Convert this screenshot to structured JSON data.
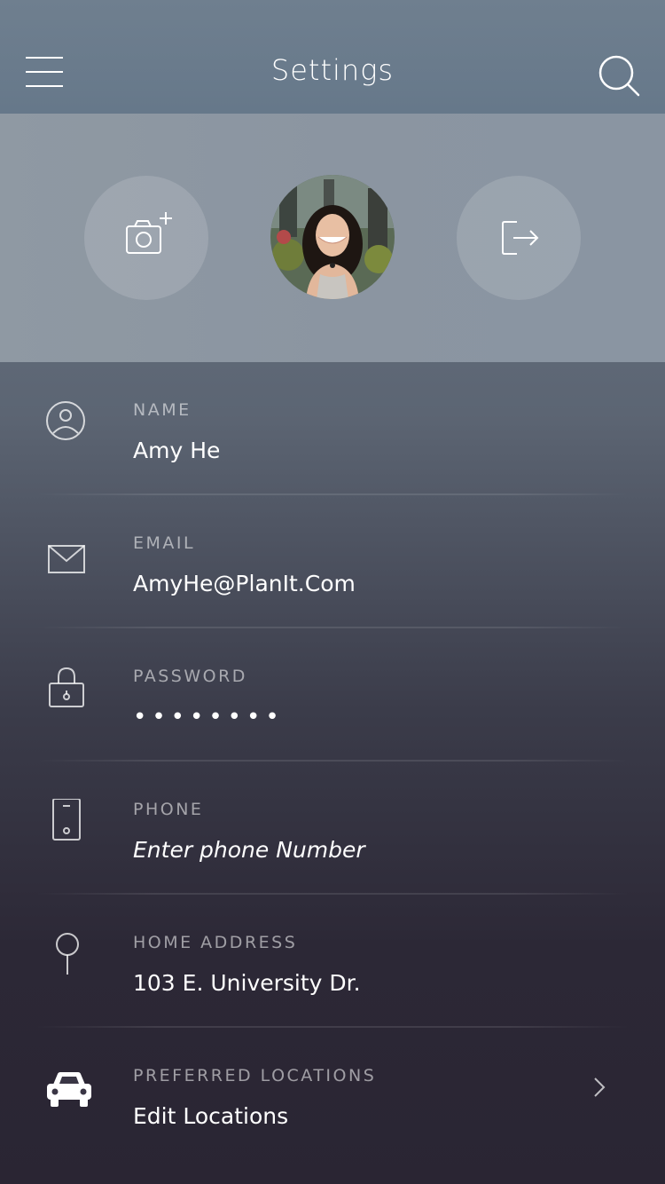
{
  "header": {
    "title": "Settings",
    "menu_icon": "hamburger-menu-icon",
    "search_icon": "search-icon"
  },
  "profile": {
    "add_photo_icon": "camera-plus-icon",
    "logout_icon": "logout-arrow-icon",
    "avatar": "user-avatar-photo"
  },
  "fields": [
    {
      "label": "NAME",
      "value": "Amy He",
      "icon": "user-circle-icon"
    },
    {
      "label": "EMAIL",
      "value": "AmyHe@PlanIt.Com",
      "icon": "envelope-icon"
    },
    {
      "label": "PASSWORD",
      "value": "••••••••",
      "icon": "lock-icon"
    },
    {
      "label": "PHONE",
      "value": "Enter phone Number",
      "icon": "phone-icon"
    },
    {
      "label": "HOME ADDRESS",
      "value": "103 E. University Dr.",
      "icon": "map-pin-icon"
    },
    {
      "label": "PREFERRED LOCATIONS",
      "value": "Edit Locations",
      "icon": "car-icon"
    }
  ],
  "colors": {
    "text": "#ffffff",
    "label": "#b7b8c0"
  }
}
